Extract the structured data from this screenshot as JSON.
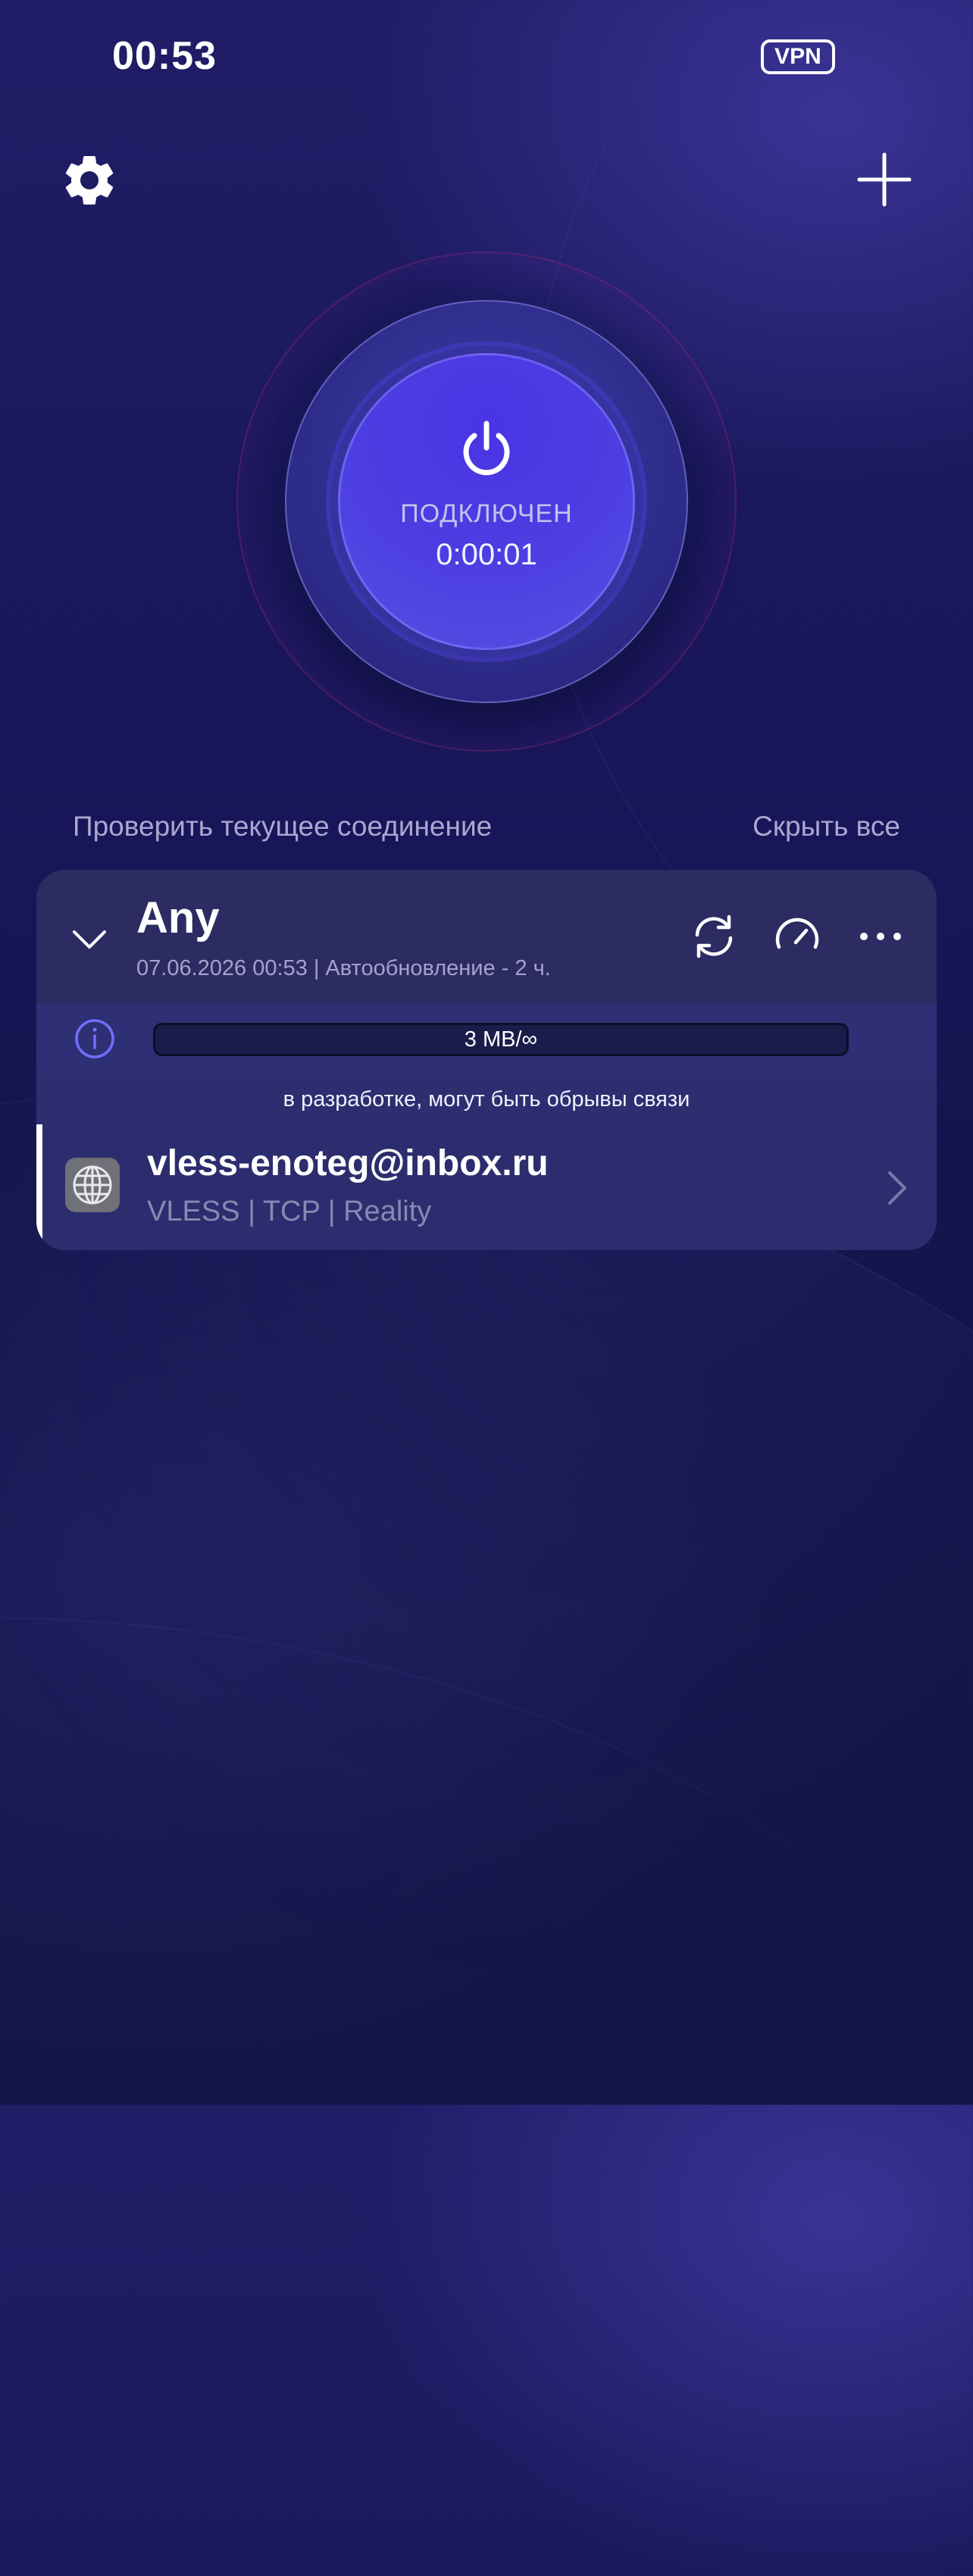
{
  "status_bar": {
    "time": "00:53",
    "vpn_badge": "VPN"
  },
  "toolbar": {
    "settings_icon": "gear-icon",
    "add_icon": "plus-icon"
  },
  "connection": {
    "icon": "power-icon",
    "status": "ПОДКЛЮЧЕН",
    "timer": "0:00:01"
  },
  "links": {
    "check_connection": "Проверить текущее соединение",
    "hide_all": "Скрыть все"
  },
  "group": {
    "title": "Any",
    "subtitle": "07.06.2026 00:53 | Автообновление - 2 ч.",
    "traffic": "3 MB/∞",
    "notice": "в разработке, могут быть обрывы связи",
    "actions": [
      "refresh-icon",
      "speedometer-icon",
      "more-icon"
    ]
  },
  "server": {
    "name": "vless-enoteg@inbox.ru",
    "meta": "VLESS | TCP | Reality",
    "icon": "globe-icon"
  },
  "colors": {
    "background": "#19175a",
    "connect_button": "#4d3fe2",
    "card": "#2a2a66",
    "accent_ring": "#aa2878",
    "info_icon": "#6f6fff"
  }
}
